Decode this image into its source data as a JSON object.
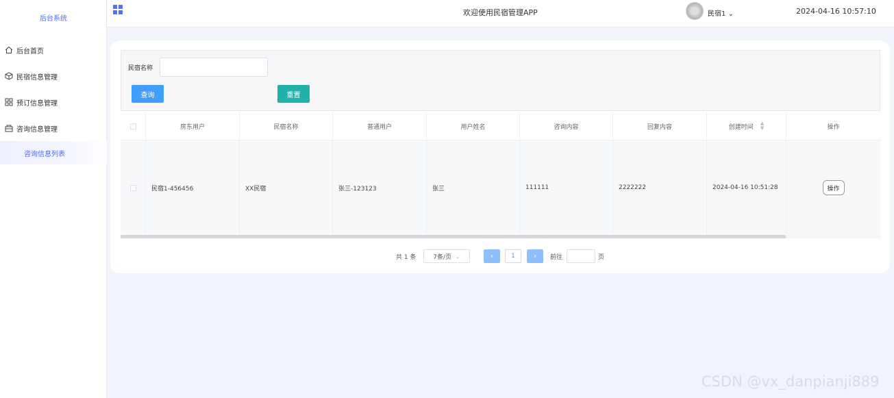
{
  "sidebar": {
    "brand": "后台系统",
    "items": [
      {
        "label": "后台首页",
        "icon": "home-icon"
      },
      {
        "label": "民宿信息管理",
        "icon": "box-icon"
      },
      {
        "label": "预订信息管理",
        "icon": "grid-icon"
      },
      {
        "label": "咨询信息管理",
        "icon": "tray-icon"
      }
    ],
    "active_submenu": "咨询信息列表"
  },
  "header": {
    "title": "欢迎使用民宿管理APP",
    "user": "民宿1",
    "datetime": "2024-04-16 10:57:10"
  },
  "search": {
    "label": "民宿名称",
    "value": "",
    "query_button": "查询",
    "reset_button": "重置"
  },
  "table": {
    "columns": [
      "房东用户",
      "民宿名称",
      "普通用户",
      "用户姓名",
      "咨询内容",
      "回复内容",
      "创建时间",
      "操作"
    ],
    "rows": [
      {
        "landlord": "民宿1-456456",
        "homestay": "XX民宿",
        "user": "张三-123123",
        "name": "张三",
        "content": "111111",
        "reply": "2222222",
        "created": "2024-04-16 10:51:28",
        "action": "操作"
      }
    ]
  },
  "pagination": {
    "total": "共 1 条",
    "page_size": "7条/页",
    "current_page": "1",
    "goto_label": "前往",
    "page_unit": "页"
  },
  "watermark": "CSDN @vx_danpianji889",
  "colors": {
    "primary": "#409eff",
    "reset": "#20b2aa",
    "accent": "#4b6ef5"
  }
}
